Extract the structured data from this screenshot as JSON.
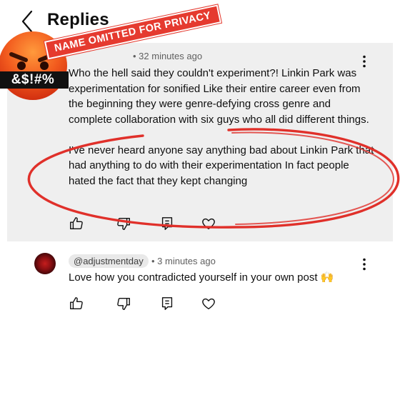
{
  "header": {
    "title": "Replies",
    "back_icon": "chevron-left-icon"
  },
  "main_comment": {
    "author_badge": "NAME OMITTED FOR PRIVACY",
    "emoji_badge_text": "&$!#%",
    "time": "• 32 minutes ago",
    "paragraphs": [
      "Who the hell said they couldn't experiment?! Linkin Park was experimentation for sonified Like their entire career even from the beginning they were genre-defying cross genre and complete collaboration with six guys who all did different things.",
      "I've never heard anyone say anything bad about Linkin Park that had anything to do with their experimentation In fact people hated the fact that they kept changing"
    ],
    "background": "#efefef",
    "annotation_color": "#e0302a"
  },
  "reply": {
    "handle": "@adjustmentday",
    "time": "• 3 minutes ago",
    "text": "Love how you contradicted yourself in your own post 🙌"
  },
  "actions": [
    "like-icon",
    "dislike-icon",
    "reply-icon",
    "heart-icon"
  ]
}
